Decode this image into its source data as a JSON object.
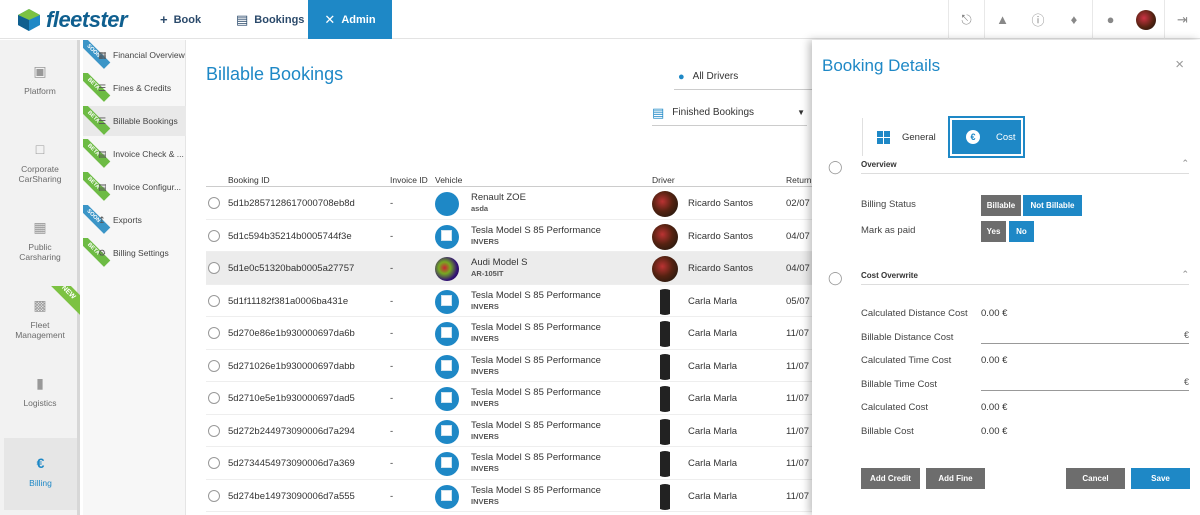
{
  "app": {
    "name": "fleetster"
  },
  "topnav": {
    "book": "Book",
    "bookings": "Bookings",
    "admin": "Admin"
  },
  "top_icons": [
    "download-icon",
    "alert-triangle-icon",
    "info-icon",
    "bell-icon",
    "globe-icon",
    "user-avatar"
  ],
  "leftnav": {
    "items": [
      {
        "label": "Platform",
        "icon": "clipboard-icon"
      },
      {
        "label": "Corporate CarSharing",
        "icon": "car-icon"
      },
      {
        "label": "Public Carsharing",
        "icon": "car-front-icon"
      },
      {
        "label": "Fleet Management",
        "icon": "truck-icon",
        "badge": "NEW"
      },
      {
        "label": "Logistics",
        "icon": "chart-icon"
      },
      {
        "label": "Billing",
        "icon": "euro-icon",
        "active": true
      }
    ]
  },
  "subnav": {
    "items": [
      {
        "label": "Financial Overview",
        "ribbon": "SOON"
      },
      {
        "label": "Fines & Credits",
        "ribbon": "BETA"
      },
      {
        "label": "Billable Bookings",
        "ribbon": "BETA",
        "active": true
      },
      {
        "label": "Invoice Check & ...",
        "ribbon": "BETA"
      },
      {
        "label": "Invoice Configur...",
        "ribbon": "BETA"
      },
      {
        "label": "Exports",
        "ribbon": "SOON"
      },
      {
        "label": "Billing Settings",
        "ribbon": "BETA"
      }
    ]
  },
  "main": {
    "title": "Billable Bookings",
    "drivers_filter": "All Drivers",
    "bookings_filter": "Finished Bookings",
    "columns": [
      "Booking ID",
      "Invoice ID",
      "Vehicle",
      "Driver",
      "Return"
    ],
    "rows": [
      {
        "id": "5d1b2857128617000708eb8d",
        "invoice": "-",
        "vehicle": "Renault ZOE",
        "sub": "asda",
        "driver": "Ricardo Santos",
        "ret": "02/07",
        "veh_av": "plain",
        "drv_av": "ricardo"
      },
      {
        "id": "5d1c594b35214b0005744f3e",
        "invoice": "-",
        "vehicle": "Tesla Model S 85 Performance",
        "sub": "INVERS",
        "driver": "Ricardo Santos",
        "ret": "04/07",
        "veh_av": "img",
        "drv_av": "ricardo"
      },
      {
        "id": "5d1e0c51320bab0005a27757",
        "invoice": "-",
        "vehicle": "Audi Model S",
        "sub": "AR-105IT",
        "driver": "Ricardo Santos",
        "ret": "04/07",
        "veh_av": "audi",
        "drv_av": "ricardo",
        "highlight": true
      },
      {
        "id": "5d1f11182f381a0006ba431e",
        "invoice": "-",
        "vehicle": "Tesla Model S 85 Performance",
        "sub": "INVERS",
        "driver": "Carla Marla",
        "ret": "05/07",
        "veh_av": "img",
        "drv_av": "carla"
      },
      {
        "id": "5d270e86e1b930000697da6b",
        "invoice": "-",
        "vehicle": "Tesla Model S 85 Performance",
        "sub": "INVERS",
        "driver": "Carla Marla",
        "ret": "11/07",
        "veh_av": "img",
        "drv_av": "carla"
      },
      {
        "id": "5d271026e1b930000697dabb",
        "invoice": "-",
        "vehicle": "Tesla Model S 85 Performance",
        "sub": "INVERS",
        "driver": "Carla Marla",
        "ret": "11/07",
        "veh_av": "img",
        "drv_av": "carla"
      },
      {
        "id": "5d2710e5e1b930000697dad5",
        "invoice": "-",
        "vehicle": "Tesla Model S 85 Performance",
        "sub": "INVERS",
        "driver": "Carla Marla",
        "ret": "11/07",
        "veh_av": "img",
        "drv_av": "carla"
      },
      {
        "id": "5d272b244973090006d7a294",
        "invoice": "-",
        "vehicle": "Tesla Model S 85 Performance",
        "sub": "INVERS",
        "driver": "Carla Marla",
        "ret": "11/07",
        "veh_av": "img",
        "drv_av": "carla"
      },
      {
        "id": "5d2734454973090006d7a369",
        "invoice": "-",
        "vehicle": "Tesla Model S 85 Performance",
        "sub": "INVERS",
        "driver": "Carla Marla",
        "ret": "11/07",
        "veh_av": "img",
        "drv_av": "carla"
      },
      {
        "id": "5d274be14973090006d7a555",
        "invoice": "-",
        "vehicle": "Tesla Model S 85 Performance",
        "sub": "INVERS",
        "driver": "Carla Marla",
        "ret": "11/07",
        "veh_av": "img",
        "drv_av": "carla"
      }
    ]
  },
  "panel": {
    "title": "Booking Details",
    "close": "×",
    "tab_general": "General",
    "tab_cost": "Cost",
    "cost_symbol": "€",
    "overview_title": "Overview",
    "billing_status_label": "Billing Status",
    "billable_btn": "Billable",
    "not_billable_btn": "Not Billable",
    "mark_paid_label": "Mark as paid",
    "yes_btn": "Yes",
    "no_btn": "No",
    "cost_overwrite_title": "Cost Overwrite",
    "calc_distance_label": "Calculated Distance Cost",
    "calc_distance_value": "0.00 €",
    "billable_distance_label": "Billable Distance Cost",
    "billable_distance_unit": "€",
    "calc_time_label": "Calculated Time Cost",
    "calc_time_value": "0.00 €",
    "billable_time_label": "Billable Time Cost",
    "billable_time_unit": "€",
    "calc_cost_label": "Calculated Cost",
    "calc_cost_value": "0.00 €",
    "billable_cost_label": "Billable Cost",
    "billable_cost_value": "0.00 €",
    "add_credit": "Add Credit",
    "add_fine": "Add Fine",
    "cancel": "Cancel",
    "save": "Save"
  },
  "colors": {
    "accent": "#1e88c6",
    "beta": "#6dbb44",
    "soon": "#3b95c7",
    "button_gray": "#6d6d6d"
  }
}
